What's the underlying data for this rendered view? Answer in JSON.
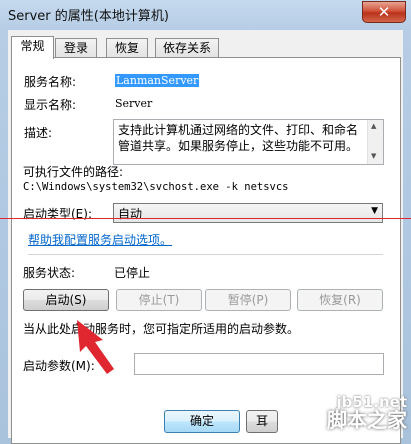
{
  "window": {
    "title": "Server 的属性(本地计算机)",
    "close_glyph": "✕"
  },
  "tabs": [
    {
      "label": "常规",
      "active": true
    },
    {
      "label": "登录",
      "active": false
    },
    {
      "label": "恢复",
      "active": false
    },
    {
      "label": "依存关系",
      "active": false
    }
  ],
  "general": {
    "service_name_label": "服务名称:",
    "service_name_value": "LanmanServer",
    "display_name_label": "显示名称:",
    "display_name_value": "Server",
    "description_label": "描述:",
    "description_value": "支持此计算机通过网络的文件、打印、和命名管道共享。如果服务停止，这些功能不可用。",
    "exec_path_label": "可执行文件的路径:",
    "exec_path_value": "C:\\Windows\\system32\\svchost.exe -k netsvcs",
    "startup_type_label": "启动类型(E):",
    "startup_type_value": "自动",
    "help_link": "帮助我配置服务启动选项。",
    "status_label": "服务状态:",
    "status_value": "已停止",
    "buttons": {
      "start": "启动(S)",
      "stop": "停止(T)",
      "pause": "暂停(P)",
      "resume": "恢复(R)"
    },
    "hint": "当从此处启动服务时，您可指定所适用的启动参数。",
    "start_params_label": "启动参数(M):",
    "start_params_value": ""
  },
  "footer": {
    "ok": "确定",
    "cancel_partial": "耳"
  },
  "watermark": {
    "line1": "jb51.net",
    "line2": "脚本之家"
  },
  "colors": {
    "annotation_red": "#e0262e",
    "selection_blue": "#3399ff",
    "link": "#0066cc"
  }
}
